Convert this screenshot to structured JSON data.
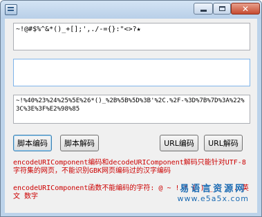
{
  "fields": {
    "input_text": "~!@#$%^&*()_+[];',./-={}:\"<>?★",
    "output_text": "",
    "encoded_text": "~!%40%23%24%25%5E%26*()_%2B%5B%5D%3B'%2C.%2F-%3D%7B%7D%3A%22%3C%3E%3F%E2%98%85"
  },
  "buttons": {
    "script_encode": "脚本编码",
    "script_decode": "脚本解码",
    "url_encode": "URL编码",
    "url_decode": "URL解码"
  },
  "notes": {
    "note1": "encodeURIComponent编码和decodeURIComponent解码只能针对UTF-8字符集的网页，不能识别GBK网页编码过的汉字编码",
    "note2": "encodeURIComponent函数不能编码的字符: @ ~ ! * ( ) _ - ' . 英文 数字"
  },
  "watermark": {
    "name": "易语言资源网",
    "url": "www.e5a5x.com"
  },
  "colors": {
    "note_text": "#cc0000",
    "watermark": "#1b6bb3",
    "focus_border": "#7eb4ea"
  }
}
